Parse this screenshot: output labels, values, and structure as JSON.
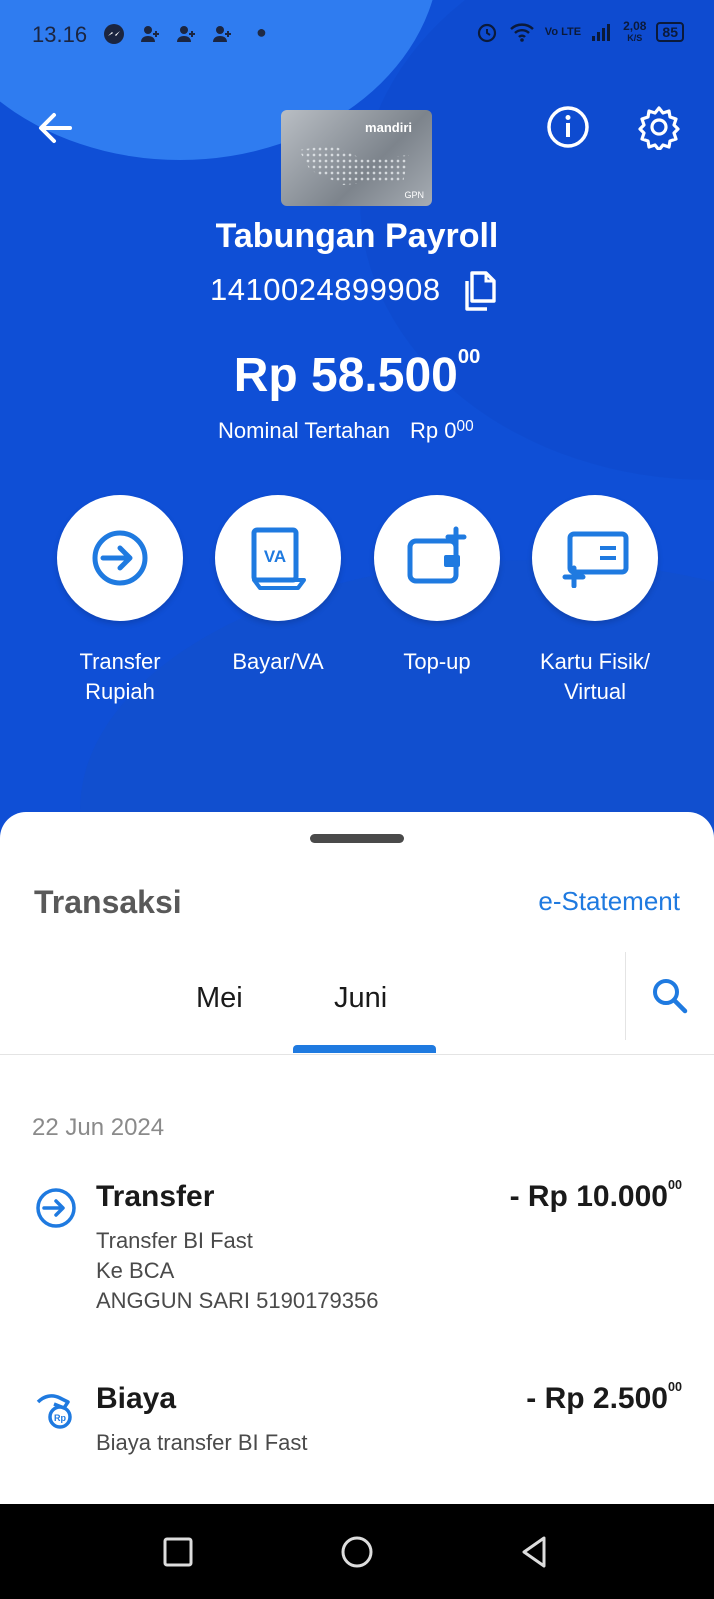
{
  "status_bar": {
    "time": "13.16",
    "network_speed": "2,08",
    "network_unit": "K/S",
    "network_type": "Vo LTE",
    "battery": "85"
  },
  "header": {
    "card_brand": "mandiri",
    "card_network": "GPN",
    "account_name": "Tabungan Payroll",
    "account_number": "1410024899908",
    "balance_main": "Rp 58.500",
    "balance_cents": "00",
    "held_label": "Nominal Tertahan",
    "held_value": "Rp 0",
    "held_cents": "00"
  },
  "actions": [
    {
      "label_line1": "Transfer",
      "label_line2": "Rupiah",
      "icon": "transfer-icon"
    },
    {
      "label_line1": "Bayar/VA",
      "label_line2": "",
      "icon": "va-bill-icon"
    },
    {
      "label_line1": "Top-up",
      "label_line2": "",
      "icon": "wallet-add-icon"
    },
    {
      "label_line1": "Kartu Fisik/",
      "label_line2": "Virtual",
      "icon": "card-add-icon"
    }
  ],
  "transactions_panel": {
    "title": "Transaksi",
    "estatement": "e-Statement",
    "tabs": [
      "Mei",
      "Juni"
    ],
    "active_tab": "Juni",
    "date": "22 Jun 2024",
    "items": [
      {
        "name": "Transfer",
        "amount": "- Rp 10.000",
        "cents": "00",
        "details": [
          "Transfer BI Fast",
          "Ke BCA",
          "ANGGUN SARI 5190179356"
        ],
        "icon": "transfer-out-icon"
      },
      {
        "name": "Biaya",
        "amount": "- Rp 2.500",
        "cents": "00",
        "details": [
          "Biaya transfer BI Fast"
        ],
        "icon": "fee-icon"
      }
    ]
  },
  "colors": {
    "primary": "#0f4fd6",
    "accent": "#1f7ae0"
  }
}
